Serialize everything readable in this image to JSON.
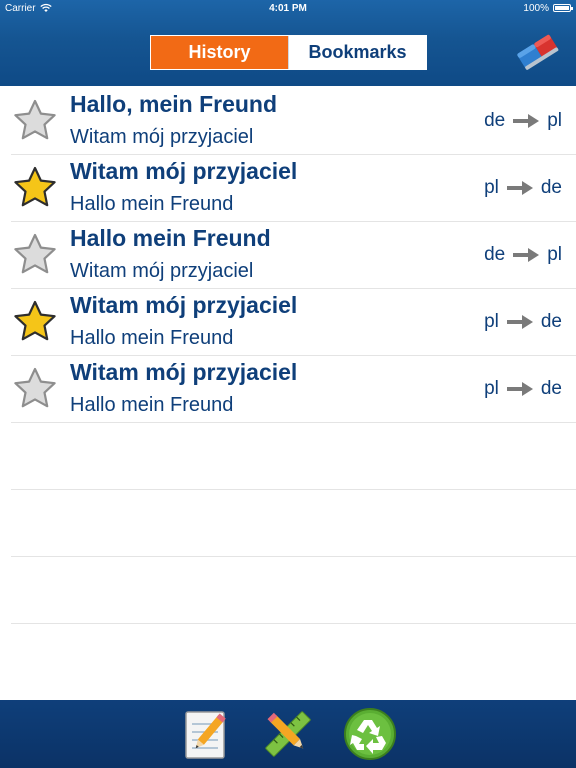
{
  "status": {
    "carrier": "Carrier",
    "time": "4:01 PM",
    "battery": "100%"
  },
  "nav": {
    "tabs": [
      {
        "label": "History",
        "active": true
      },
      {
        "label": "Bookmarks",
        "active": false
      }
    ],
    "clear_icon": "eraser-icon"
  },
  "entries": [
    {
      "source": "Hallo, mein Freund",
      "translation": "Witam mój przyjaciel",
      "from": "de",
      "to": "pl",
      "bookmarked": false
    },
    {
      "source": "Witam mój przyjaciel",
      "translation": "Hallo mein Freund",
      "from": "pl",
      "to": "de",
      "bookmarked": true
    },
    {
      "source": "Hallo mein Freund",
      "translation": "Witam mój przyjaciel",
      "from": "de",
      "to": "pl",
      "bookmarked": false
    },
    {
      "source": "Witam mój przyjaciel",
      "translation": "Hallo mein Freund",
      "from": "pl",
      "to": "de",
      "bookmarked": true
    },
    {
      "source": "Witam mój przyjaciel",
      "translation": "Hallo mein Freund",
      "from": "pl",
      "to": "de",
      "bookmarked": false
    }
  ],
  "toolbar": {
    "items": [
      "notepad-pencil-icon",
      "pencil-ruler-icon",
      "recycle-icon"
    ]
  },
  "colors": {
    "nav_blue": "#155592",
    "accent_orange": "#f26a15",
    "text_blue": "#0f3f7a",
    "star_gold": "#f5c518",
    "star_gray": "#d9d9d9"
  }
}
